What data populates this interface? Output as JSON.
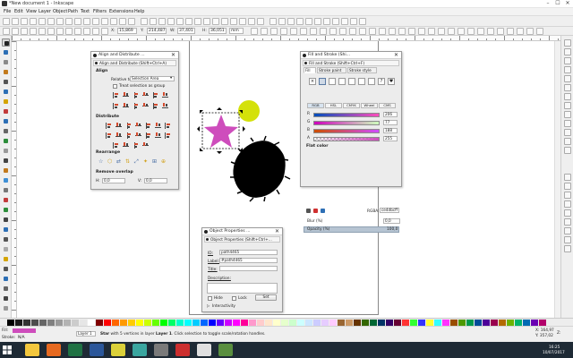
{
  "window": {
    "title": "*New document 1 - Inkscape",
    "minimize": "–",
    "maximize": "☐",
    "close": "✕"
  },
  "menu": [
    "File",
    "Edit",
    "View",
    "Layer",
    "Object",
    "Path",
    "Text",
    "Filters",
    "Extensions",
    "Help"
  ],
  "controls": {
    "x_label": "X:",
    "x_value": "15,869",
    "y_label": "Y:",
    "y_value": "214,487",
    "w_label": "W:",
    "w_value": "37,401",
    "h_label": "H:",
    "h_value": "36,051",
    "unit": "mm"
  },
  "align_dialog": {
    "title": "Align and Distribute ...",
    "subtitle": "Align and Distribute (Shift+Ctrl+A)",
    "align_label": "Align",
    "relative_to_label": "Relative to:",
    "relative_to_value": "Selection Area",
    "treat_group_label": "Treat selection as group",
    "distribute_label": "Distribute",
    "rearrange_label": "Rearrange",
    "remove_overlap_label": "Remove overlap",
    "h_label": "H:",
    "h_value": "0,0",
    "v_label": "V:",
    "v_value": "0,0"
  },
  "fill_dialog": {
    "title": "Fill and Stroke (Shi...",
    "subtitle": "Fill and Stroke (Shift+Ctrl+F)",
    "tabs": [
      "Fill",
      "Stroke paint",
      "Stroke style"
    ],
    "paint_types": [
      "×",
      "",
      "",
      "",
      "",
      "",
      "",
      "?",
      "♥"
    ],
    "flat_color_label": "Flat color",
    "color_modes": [
      "RGB",
      "HSL",
      "CMYK",
      "Wheel",
      "CMS"
    ],
    "channels": [
      {
        "name": "R",
        "value": "206"
      },
      {
        "name": "G",
        "value": "77"
      },
      {
        "name": "B",
        "value": "188"
      },
      {
        "name": "A",
        "value": "255"
      }
    ],
    "rgba_label": "RGBA:",
    "rgba_value": "ce4dbcff",
    "blur_label": "Blur (%)",
    "blur_value": "0,0",
    "opacity_label": "Opacity (%)",
    "opacity_value": "100,0"
  },
  "props_dialog": {
    "title": "Object Properties ...",
    "subtitle": "Object Properties (Shift+Ctrl+...",
    "id_label": "ID:",
    "id_value": "path4465",
    "label_label": "Label:",
    "label_value": "#path4465",
    "title_label": "Title:",
    "title_value": "",
    "description_label": "Description:",
    "hide_label": "Hide",
    "lock_label": "Lock",
    "set_label": "Set",
    "interactivity_label": "Interactivity"
  },
  "status": {
    "fill_label": "Fill:",
    "stroke_label": "Stroke:",
    "stroke_value": "N/A",
    "layer": "Layer 1",
    "message_bold": "Star",
    "message_rest": " with 5 vertices in layer ",
    "message_layer": "Layer 1",
    "message_end": ". Click selection to toggle scale/rotation handles.",
    "x_coord": "X: 164,97",
    "y_coord": "Y: 357,02",
    "z_label": "Z:",
    "zoom": "35%"
  },
  "clock": {
    "time": "16:25",
    "date": "10/07/2017"
  },
  "colors": {
    "star": "#ce4dbc",
    "circle": "#d4e10a",
    "blob": "#000000",
    "fill_swatch": "#ce4dbc",
    "taskbar": "#1e2a35"
  },
  "palette_colors": [
    "#000000",
    "#1a1a1a",
    "#333333",
    "#4d4d4d",
    "#666666",
    "#808080",
    "#999999",
    "#b3b3b3",
    "#cccccc",
    "#e6e6e6",
    "#ffffff",
    "#800000",
    "#ff0000",
    "#ff6600",
    "#ff9900",
    "#ffcc00",
    "#ffff00",
    "#ccff00",
    "#66ff00",
    "#00ff00",
    "#00ff66",
    "#00ffcc",
    "#00ffff",
    "#00ccff",
    "#0066ff",
    "#0000ff",
    "#6600ff",
    "#cc00ff",
    "#ff00ff",
    "#ff0099",
    "#ff99cc",
    "#ffcccc",
    "#ffe6cc",
    "#ffffcc",
    "#e6ffcc",
    "#ccffcc",
    "#ccffff",
    "#cce6ff",
    "#ccccff",
    "#e6ccff",
    "#ffccff",
    "#996633",
    "#cc9966",
    "#663300",
    "#336600",
    "#006633",
    "#003366",
    "#330066",
    "#660033",
    "#ff3333",
    "#33ff33",
    "#3333ff",
    "#ffff33",
    "#33ffff",
    "#ff33ff",
    "#994d00",
    "#4d9900",
    "#00994d",
    "#004d99",
    "#4d0099",
    "#99004d",
    "#b36b00",
    "#6bb300",
    "#00b36b",
    "#006bb3",
    "#6b00b3",
    "#b3006b"
  ],
  "taskbar_apps": [
    {
      "name": "explorer",
      "color": "#f3c73d"
    },
    {
      "name": "firefox",
      "color": "#e66a21"
    },
    {
      "name": "excel",
      "color": "#1f7244"
    },
    {
      "name": "word",
      "color": "#2b579a"
    },
    {
      "name": "chrome",
      "color": "#dbd13a"
    },
    {
      "name": "app6",
      "color": "#3aa6a0"
    },
    {
      "name": "app7",
      "color": "#7a7a7a"
    },
    {
      "name": "app8",
      "color": "#cc2f2f"
    },
    {
      "name": "inkscape",
      "color": "#e0e0e0"
    },
    {
      "name": "app10",
      "color": "#5a8f3f"
    }
  ]
}
